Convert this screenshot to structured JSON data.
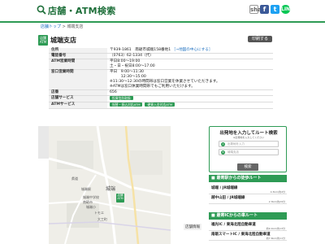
{
  "header": {
    "title": "店舗・ATM検索",
    "social": [
      "share",
      "f",
      "t",
      "LINE"
    ]
  },
  "breadcrumb": {
    "top": "店舗トップ",
    "sep": " > ",
    "current": "城端支店"
  },
  "branch": {
    "badge": "店舗 ATM",
    "name": "城端支店",
    "print": "印刷する"
  },
  "info": {
    "rows": [
      {
        "label": "住所",
        "value": "〒939-1861　南砺市城端158番地1",
        "link": "［→地図の中心にする］"
      },
      {
        "label": "電話番号",
        "value": "（0763）62-1334（代）"
      },
      {
        "label": "ATM営業時間",
        "lines": [
          "平日8:00～19:00",
          "土・日・祝日8:00～17:00"
        ]
      },
      {
        "label": "窓口営業時間",
        "lines": [
          "平日　9:00～11:30",
          "　　　12:30～15:00",
          "※11:30～12:30の時間帯は窓口営業を休業させていただきます。",
          "※ATMは窓口休業時間帯でもご利用いただけます。"
        ]
      },
      {
        "label": "店番",
        "value": "656"
      },
      {
        "label": "店舗サービス",
        "tags": [
          "投資信託取扱"
        ]
      },
      {
        "label": "ATMサービス",
        "tags": [
          "振替・振込対応ATM",
          "硬貨入金対応ATM"
        ]
      }
    ]
  },
  "map": {
    "labels": [
      "城端",
      "城端駅",
      "県道",
      "城端中学校",
      "南砺市",
      "城端小",
      "トモエ",
      "大工町"
    ]
  },
  "route": {
    "title": "出発地を入力してルート検索",
    "sub": "※出発地を入力してください",
    "from_placeholder": "出発地を入力",
    "to_placeholder": "城端支店",
    "search": "検索"
  },
  "walk": {
    "heading": "最寄駅からの徒歩ルート",
    "items": [
      {
        "name": "城端 / JR城端線",
        "dist": "0.3km/約4分"
      },
      {
        "name": "越中山田 / JR城端線",
        "dist": "2.3km/約29分"
      }
    ]
  },
  "car": {
    "heading": "最寄ICからの車ルート",
    "items": [
      {
        "name": "福光IC / 東海北陸自動車道",
        "dist": "約9.1km/約13分"
      },
      {
        "name": "南砺スマートIC / 東海北陸自動車道",
        "dist": "約7.6km/約11分"
      }
    ]
  },
  "bottom_tag": "店舗情報"
}
